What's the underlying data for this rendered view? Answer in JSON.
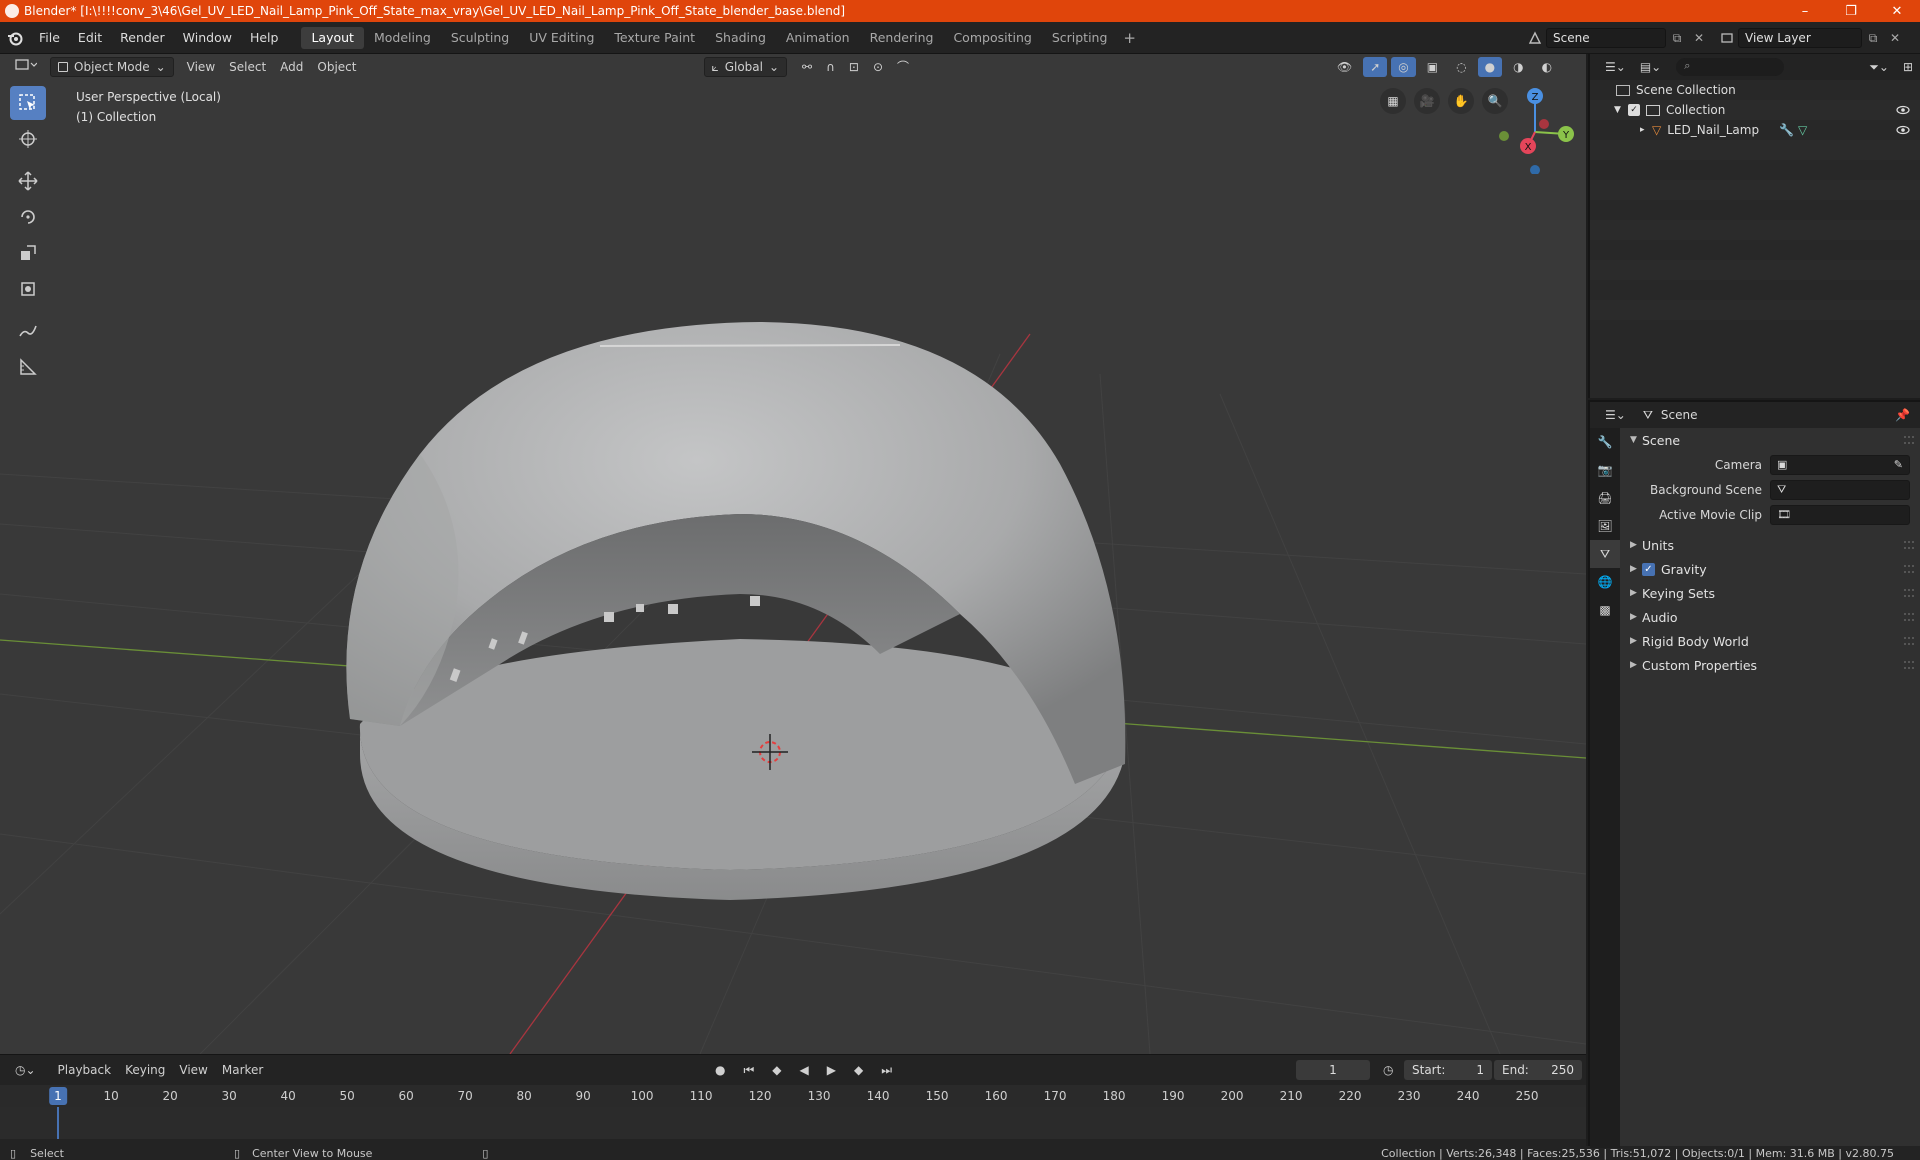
{
  "window": {
    "title": "Blender* [I:\\!!!!conv_3\\46\\Gel_UV_LED_Nail_Lamp_Pink_Off_State_max_vray\\Gel_UV_LED_Nail_Lamp_Pink_Off_State_blender_base.blend]",
    "controls": [
      "–",
      "❐",
      "✕"
    ]
  },
  "menubar": {
    "menus": [
      "File",
      "Edit",
      "Render",
      "Window",
      "Help"
    ],
    "workspaces": [
      "Layout",
      "Modeling",
      "Sculpting",
      "UV Editing",
      "Texture Paint",
      "Shading",
      "Animation",
      "Rendering",
      "Compositing",
      "Scripting"
    ],
    "active_workspace": "Layout",
    "add_symbol": "+",
    "scene_name": "Scene",
    "view_layer": "View Layer"
  },
  "viewport": {
    "mode": "Object Mode",
    "menus": [
      "View",
      "Select",
      "Add",
      "Object"
    ],
    "orientation": "Global",
    "perspective_label": "User Perspective (Local)",
    "collection_label": "(1) Collection",
    "gizmo_axes": {
      "x": "X",
      "y": "Y",
      "z": "Z"
    }
  },
  "timeline": {
    "menus": [
      "Playback",
      "Keying",
      "View",
      "Marker"
    ],
    "current_frame": "1",
    "start_label": "Start:",
    "start_value": "1",
    "end_label": "End:",
    "end_value": "250",
    "ticks": [
      "10",
      "20",
      "30",
      "40",
      "50",
      "60",
      "70",
      "80",
      "90",
      "100",
      "110",
      "120",
      "130",
      "140",
      "150",
      "160",
      "170",
      "180",
      "190",
      "200",
      "210",
      "220",
      "230",
      "240",
      "250"
    ]
  },
  "statusbar": {
    "left_action": "Select",
    "mid_action": "Center View to Mouse",
    "stats": "Collection | Verts:26,348 | Faces:25,536 | Tris:51,072 | Objects:0/1 | Mem: 31.6 MB | v2.80.75"
  },
  "outliner": {
    "root": "Scene Collection",
    "collection": "Collection",
    "object": "LED_Nail_Lamp"
  },
  "properties": {
    "context": "Scene",
    "panel_title": "Scene",
    "fields": [
      {
        "label": "Camera"
      },
      {
        "label": "Background Scene"
      },
      {
        "label": "Active Movie Clip"
      }
    ],
    "subpanels": [
      "Units",
      "Gravity",
      "Keying Sets",
      "Audio",
      "Rigid Body World",
      "Custom Properties"
    ],
    "gravity_checked": true
  },
  "colors": {
    "title_bar": "#e0450b",
    "accent_blue": "#4772b3",
    "viewport_bg": "#393939",
    "axis_x": "#e4455a",
    "axis_y": "#8bc34a",
    "axis_z": "#4a90e2"
  }
}
